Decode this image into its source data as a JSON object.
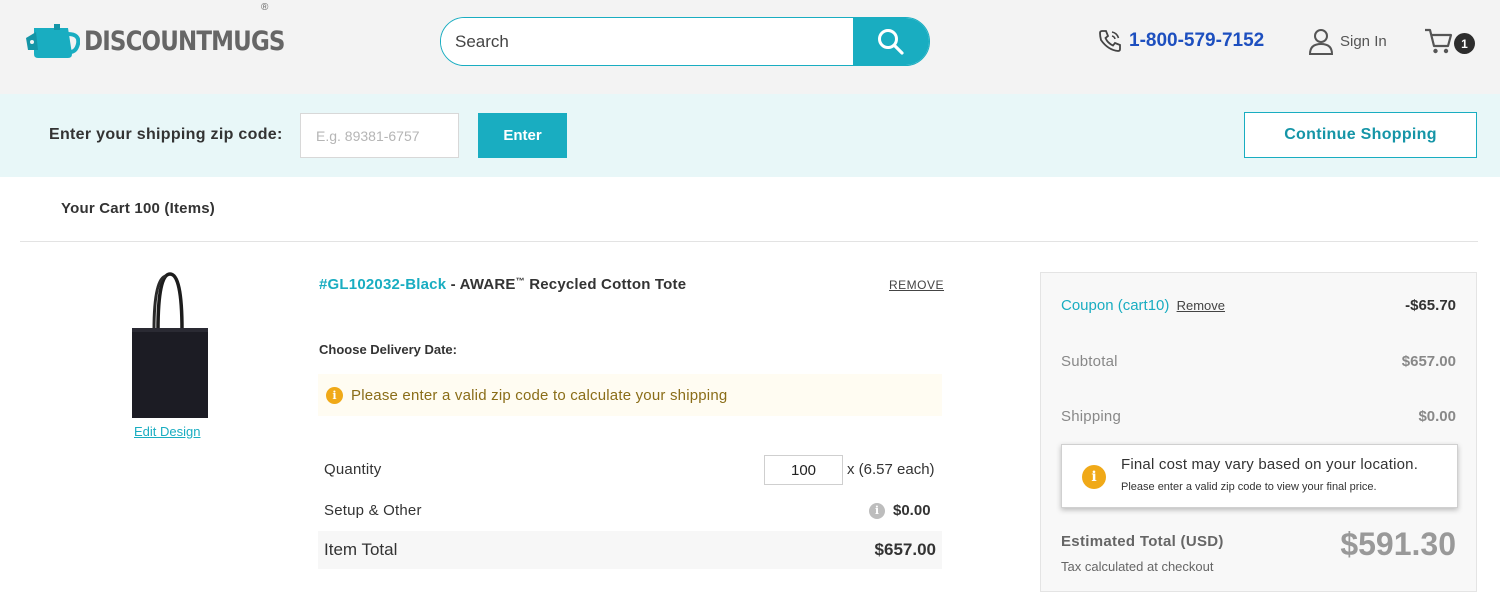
{
  "header": {
    "logo_text": "DISCOUNTMUGS",
    "logo_reg": "®",
    "search_placeholder": "Search",
    "phone": "1-800-579-7152",
    "sign_in": "Sign In",
    "cart_count": "1"
  },
  "zip_bar": {
    "label": "Enter your shipping zip code:",
    "placeholder": "E.g. 89381-6757",
    "enter_label": "Enter",
    "continue_label": "Continue Shopping"
  },
  "cart": {
    "title": "Your Cart 100 (Items)"
  },
  "product": {
    "sku": "#GL102032-Black",
    "title_prefix": " - AWARE",
    "trademark": "™",
    "title_suffix": " Recycled Cotton Tote",
    "remove_label": "REMOVE",
    "edit_design_label": "Edit Design",
    "delivery_label": "Choose Delivery Date:",
    "zip_notice": "Please enter a valid zip code to calculate your shipping",
    "quantity_label": "Quantity",
    "quantity_value": "100",
    "each_price": "x (6.57 each)",
    "setup_label": "Setup & Other",
    "setup_value": "$0.00",
    "item_total_label": "Item Total",
    "item_total_value": "$657.00"
  },
  "summary": {
    "coupon_label": "Coupon (cart10)",
    "coupon_remove": "Remove",
    "coupon_value": "-$65.70",
    "subtotal_label": "Subtotal",
    "subtotal_value": "$657.00",
    "shipping_label": "Shipping",
    "shipping_value": "$0.00",
    "tooltip_title": "Final cost may vary based on your location.",
    "tooltip_sub": "Please enter a valid zip code to view your final price.",
    "estimated_label": "Estimated Total (USD)",
    "estimated_value": "$591.30",
    "tax_note": "Tax calculated at checkout"
  },
  "colors": {
    "accent": "#19adc1",
    "phone": "#1d4fbf",
    "warning": "#f0a918"
  }
}
